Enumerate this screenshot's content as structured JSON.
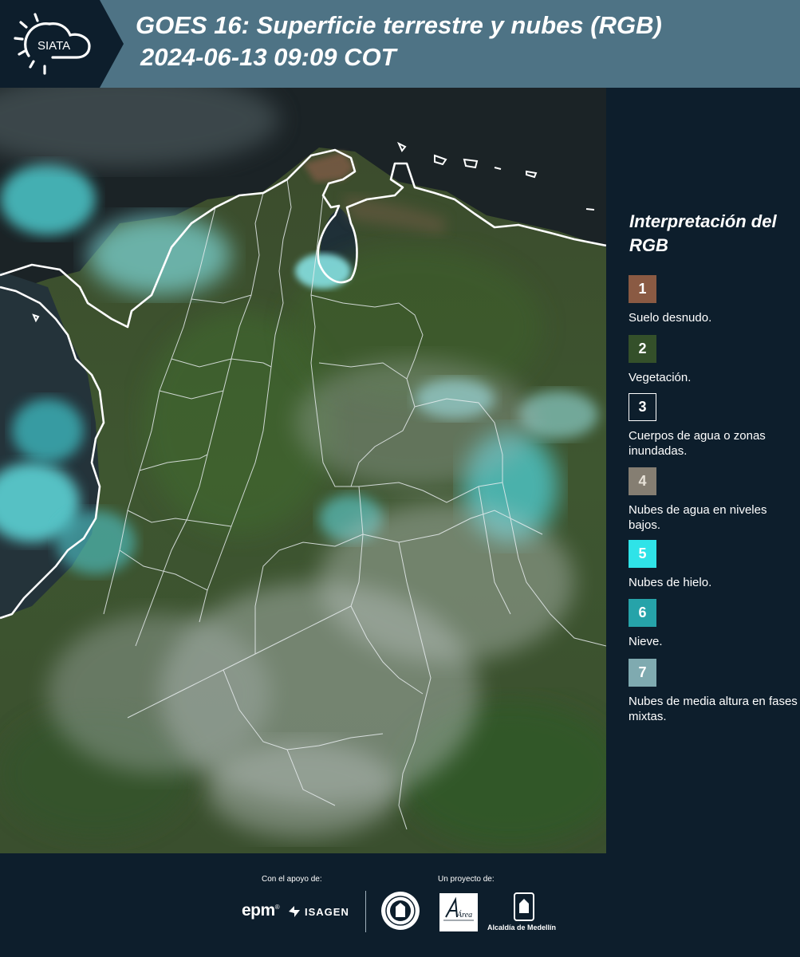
{
  "header": {
    "logo_text": "SIATA",
    "title_line1": "GOES 16: Superficie terrestre y nubes (RGB)",
    "title_line2": "2024-06-13 09:09 COT"
  },
  "legend": {
    "title": "Interpretación del RGB",
    "items": [
      {
        "number": "1",
        "label": "Suelo desnudo.",
        "color": "#8a5a43"
      },
      {
        "number": "2",
        "label": "Vegetación.",
        "color": "#34502a"
      },
      {
        "number": "3",
        "label": "Cuerpos de agua o zonas inundadas.",
        "color": "#0d1e2c"
      },
      {
        "number": "4",
        "label": "Nubes de agua en niveles bajos.",
        "color": "#857e72"
      },
      {
        "number": "5",
        "label": "Nubes de hielo.",
        "color": "#2fe3e8"
      },
      {
        "number": "6",
        "label": "Nieve.",
        "color": "#26a3a9"
      },
      {
        "number": "7",
        "label": "Nubes de media altura en fases mixtas.",
        "color": "#7faab0"
      }
    ]
  },
  "footer": {
    "support_label": "Con el apoyo de:",
    "project_label": "Un proyecto de:",
    "epm": "epm",
    "isagen": "ISAGEN",
    "area_text": "Área",
    "alcaldia": "Alcaldía de Medellín"
  }
}
